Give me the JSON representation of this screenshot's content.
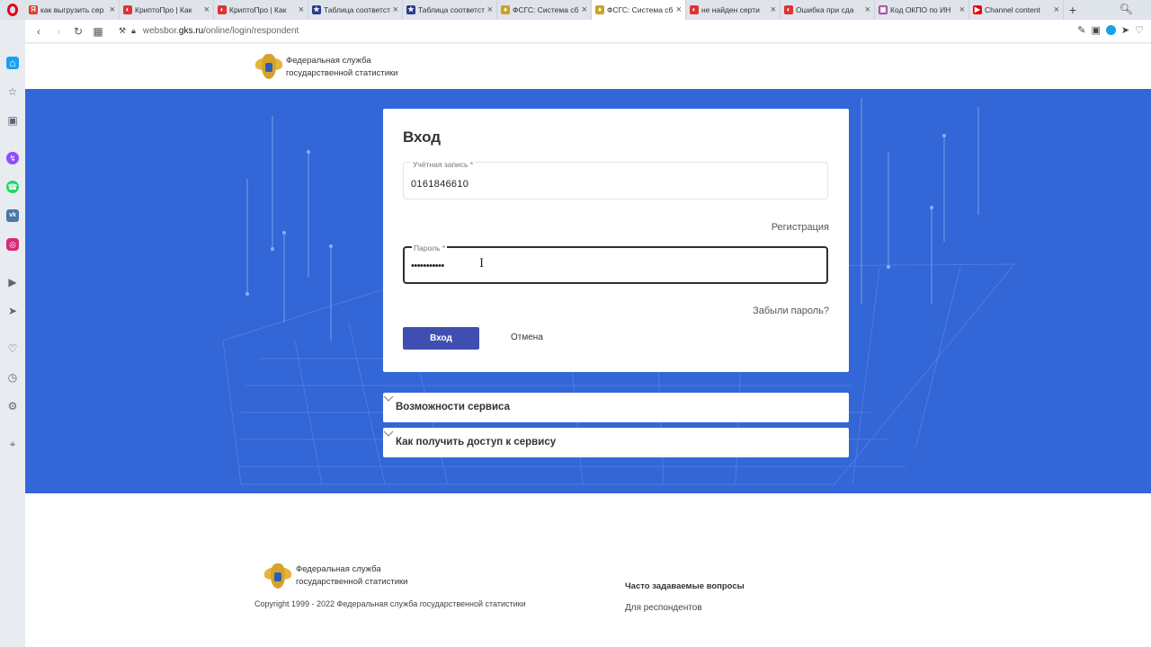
{
  "browser": {
    "tabs": [
      {
        "title": "как выгрузить сер",
        "favicon_color": "#e33b2e",
        "favicon_glyph": "Я"
      },
      {
        "title": "КриптоПро | Как",
        "favicon_color": "#d33",
        "favicon_glyph": "◐"
      },
      {
        "title": "КриптоПро | Как",
        "favicon_color": "#d33",
        "favicon_glyph": "◐"
      },
      {
        "title": "Таблица соответст",
        "favicon_color": "#2b3a8c",
        "favicon_glyph": "★"
      },
      {
        "title": "Таблица соответст",
        "favicon_color": "#2b3a8c",
        "favicon_glyph": "★"
      },
      {
        "title": "ФСГС: Система сб",
        "favicon_color": "#c9a227",
        "favicon_glyph": "♦"
      },
      {
        "title": "ФСГС: Система сб",
        "favicon_color": "#c9a227",
        "favicon_glyph": "♦",
        "active": true
      },
      {
        "title": "не найден серти",
        "favicon_color": "#d33",
        "favicon_glyph": "◐"
      },
      {
        "title": "Ошибка при сда",
        "favicon_color": "#d33",
        "favicon_glyph": "◐"
      },
      {
        "title": "Код ОКПО по ИН",
        "favicon_color": "#a040a0",
        "favicon_glyph": "▣"
      },
      {
        "title": "Channel content",
        "favicon_color": "#e00",
        "favicon_glyph": "▶"
      }
    ],
    "url_prefix": "websbor.",
    "url_domain": "gks.ru",
    "url_path": "/online/login/respondent"
  },
  "header": {
    "org_line1": "Федеральная служба",
    "org_line2": "государственной статистики"
  },
  "login": {
    "title": "Вход",
    "account_label": "Учётная запись *",
    "account_value": "0161846610",
    "register_link": "Регистрация",
    "password_label": "Пароль *",
    "password_value": "•••••••••••",
    "forgot_link": "Забыли пароль?",
    "submit_label": "Вход",
    "cancel_label": "Отмена"
  },
  "accordion": {
    "item1": "Возможности сервиса",
    "item2": "Как получить доступ к сервису"
  },
  "footer": {
    "org_line1": "Федеральная служба",
    "org_line2": "государственной статистики",
    "copyright": "Copyright 1999 - 2022 Федеральная служба государственной статистики",
    "faq_title": "Часто задаваемые вопросы",
    "faq_link": "Для респондентов"
  },
  "colors": {
    "hero_bg": "#3366d6",
    "primary_button": "#3e4fb1"
  }
}
